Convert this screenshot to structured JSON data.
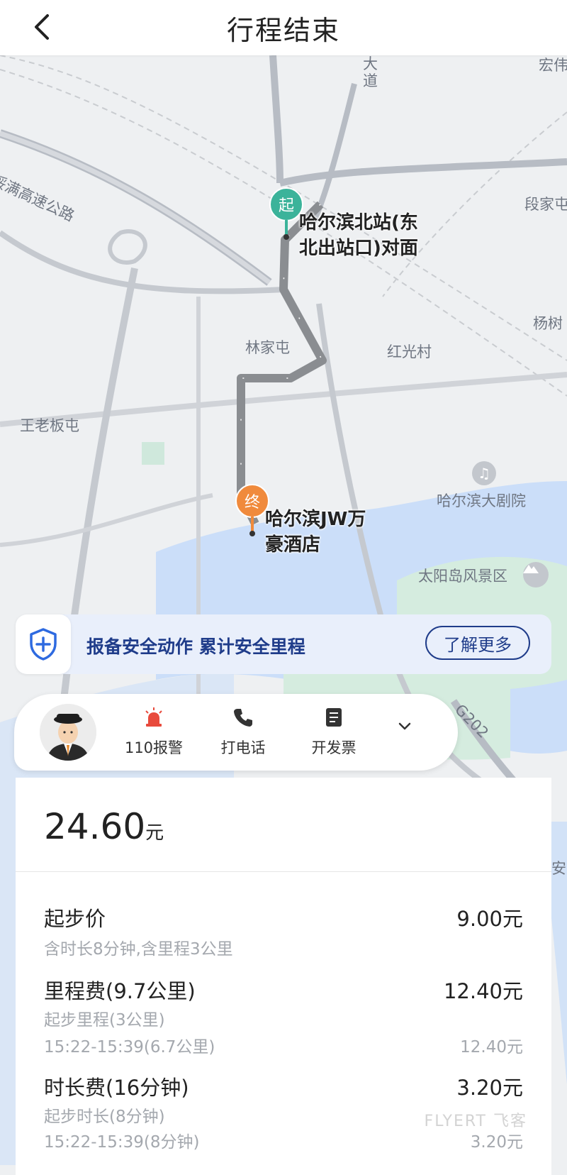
{
  "header": {
    "title": "行程结束"
  },
  "map": {
    "labels": {
      "highway": "绥满高速公路",
      "avenue": "大道",
      "hongwei": "宏伟",
      "duanjia": "段家屯",
      "yanglin": "杨树",
      "linjiatun": "林家屯",
      "hongguang": "红光村",
      "wanglaoban": "王老板屯",
      "theatre": "哈尔滨大剧院",
      "sunisland": "太阳岛风景区",
      "road_g202": "G202",
      "an": "安"
    },
    "start": {
      "marker": "起",
      "name_line1": "哈尔滨北站(东",
      "name_line2": "北出站口)对面"
    },
    "end": {
      "marker": "终",
      "name_line1": "哈尔滨JW万",
      "name_line2": "豪酒店"
    }
  },
  "safety_banner": {
    "text": "报备安全动作 累计安全里程",
    "button": "了解更多"
  },
  "driver_actions": [
    {
      "icon": "alarm-icon",
      "label": "110报警",
      "color": "#e84a3c"
    },
    {
      "icon": "phone-icon",
      "label": "打电话"
    },
    {
      "icon": "invoice-icon",
      "label": "开发票"
    }
  ],
  "fare": {
    "total": "24.60",
    "unit": "元",
    "rows": [
      {
        "name": "起步价",
        "value": "9.00元",
        "subs": [
          {
            "text": "含时长8分钟,含里程3公里",
            "value": ""
          }
        ]
      },
      {
        "name": "里程费(9.7公里)",
        "value": "12.40元",
        "subs": [
          {
            "text": "起步里程(3公里)",
            "value": ""
          },
          {
            "text": "15:22-15:39(6.7公里)",
            "value": "12.40元"
          }
        ]
      },
      {
        "name": "时长费(16分钟)",
        "value": "3.20元",
        "subs": [
          {
            "text": "起步时长(8分钟)",
            "value": ""
          },
          {
            "text": "15:22-15:39(8分钟)",
            "value": "3.20元"
          }
        ]
      }
    ]
  },
  "watermark": "FLYERT 飞客",
  "colors": {
    "accent": "#1f3c8a",
    "start": "#3bb39a",
    "end": "#f08a3c",
    "route": "#8a8d91"
  }
}
